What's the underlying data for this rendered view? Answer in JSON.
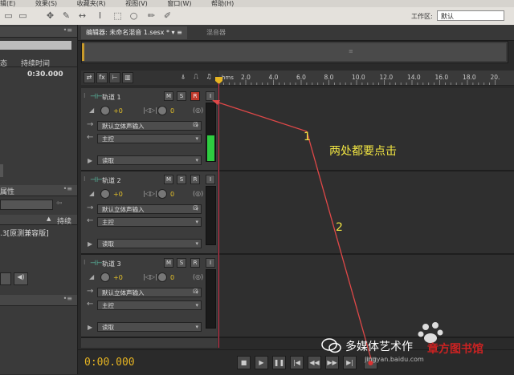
{
  "menu": [
    "辑(E)",
    "效果(S)",
    "收藏夹(R)",
    "视图(V)",
    "窗口(W)",
    "帮助(H)"
  ],
  "workspace": {
    "label": "工作区:",
    "value": "默认"
  },
  "left_panel": {
    "files_header": "•≡",
    "col_duration": "持续时间",
    "col_state": "态",
    "duration_value": "0:30.000",
    "props_header": "属性",
    "col_duration2": "持续",
    "format_item": ".3[原测兼容版]"
  },
  "tabs": {
    "editor": "编辑器: 未命名混音 1.sesx *",
    "mixer": "混音器"
  },
  "overview_grip": "≡",
  "ruler": {
    "unit": "hms",
    "ticks": [
      "2.0",
      "4.0",
      "6.0",
      "8.0",
      "10.0",
      "12.0",
      "14.0",
      "16.0",
      "18.0",
      "20."
    ]
  },
  "tracks": [
    {
      "name": "轨道 1",
      "m": "M",
      "s": "S",
      "r": "R",
      "i": "I",
      "vol": "+0",
      "pan": "0",
      "input": "默认立体声输入",
      "output": "主控",
      "automation": "读取",
      "meter_level": 0.45,
      "armed": true
    },
    {
      "name": "轨道 2",
      "m": "M",
      "s": "S",
      "r": "R",
      "i": "I",
      "vol": "+0",
      "pan": "0",
      "input": "默认立体声输入",
      "output": "主控",
      "automation": "读取",
      "meter_level": 0,
      "armed": false
    },
    {
      "name": "轨道 3",
      "m": "M",
      "s": "S",
      "r": "R",
      "i": "I",
      "vol": "+0",
      "pan": "0",
      "input": "默认立体声输入",
      "output": "主控",
      "automation": "读取",
      "meter_level": 0,
      "armed": false
    }
  ],
  "transport": {
    "timecode": "0:00.000"
  },
  "annotations": {
    "label1": "1",
    "label2": "2",
    "note": "两处都要点击"
  },
  "watermark": {
    "text": "多媒体艺术作",
    "sub": "jingyan.baidu.com",
    "overlay": "章方图书馆"
  },
  "colors": {
    "accent": "#e6b422",
    "record": "#c0392b",
    "annotation": "#f0e442",
    "playhead": "#d4314b",
    "arrow": "#e04848"
  }
}
